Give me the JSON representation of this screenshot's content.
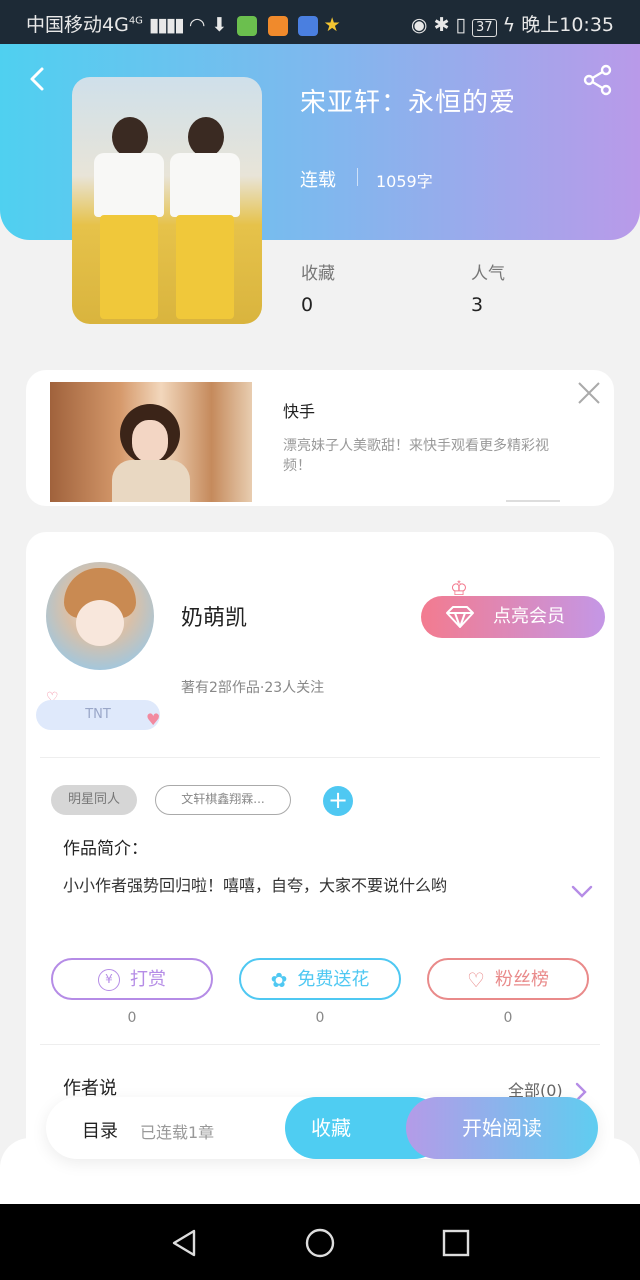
{
  "status_bar": {
    "carrier": "中国移动4G",
    "network_sup": "4G",
    "battery": "37",
    "time": "晚上10:35"
  },
  "book": {
    "title": "宋亚轩：永恒的爱",
    "status": "连载",
    "word_count": "1059字",
    "stats": [
      {
        "label": "收藏",
        "value": "0"
      },
      {
        "label": "人气",
        "value": "3"
      }
    ]
  },
  "ad": {
    "title": "快手",
    "text": "漂亮妹子人美歌甜！来快手观看更多精彩视频！"
  },
  "author": {
    "name": "奶萌凯",
    "meta": "著有2部作品·23人关注",
    "badge": "TNT",
    "vip_button": "点亮会员"
  },
  "tags": [
    "明星同人",
    "文轩棋鑫翔霖..."
  ],
  "intro": {
    "label": "作品简介：",
    "text": "小小作者强势回归啦！嘻嘻，自夸，大家不要说什么哟"
  },
  "actions": [
    {
      "label": "打赏",
      "icon": "yen-icon",
      "count": "0",
      "color": "#b58ce6"
    },
    {
      "label": "免费送花",
      "icon": "flower-icon",
      "count": "0",
      "color": "#4fc8f2"
    },
    {
      "label": "粉丝榜",
      "icon": "fans-icon",
      "count": "0",
      "color": "#e98a8a"
    }
  ],
  "author_says": {
    "label": "作者说",
    "all": "全部(0)"
  },
  "bottom_bar": {
    "toc": "目录",
    "chapters": "已连载1章",
    "favorite": "收藏",
    "read": "开始阅读"
  }
}
